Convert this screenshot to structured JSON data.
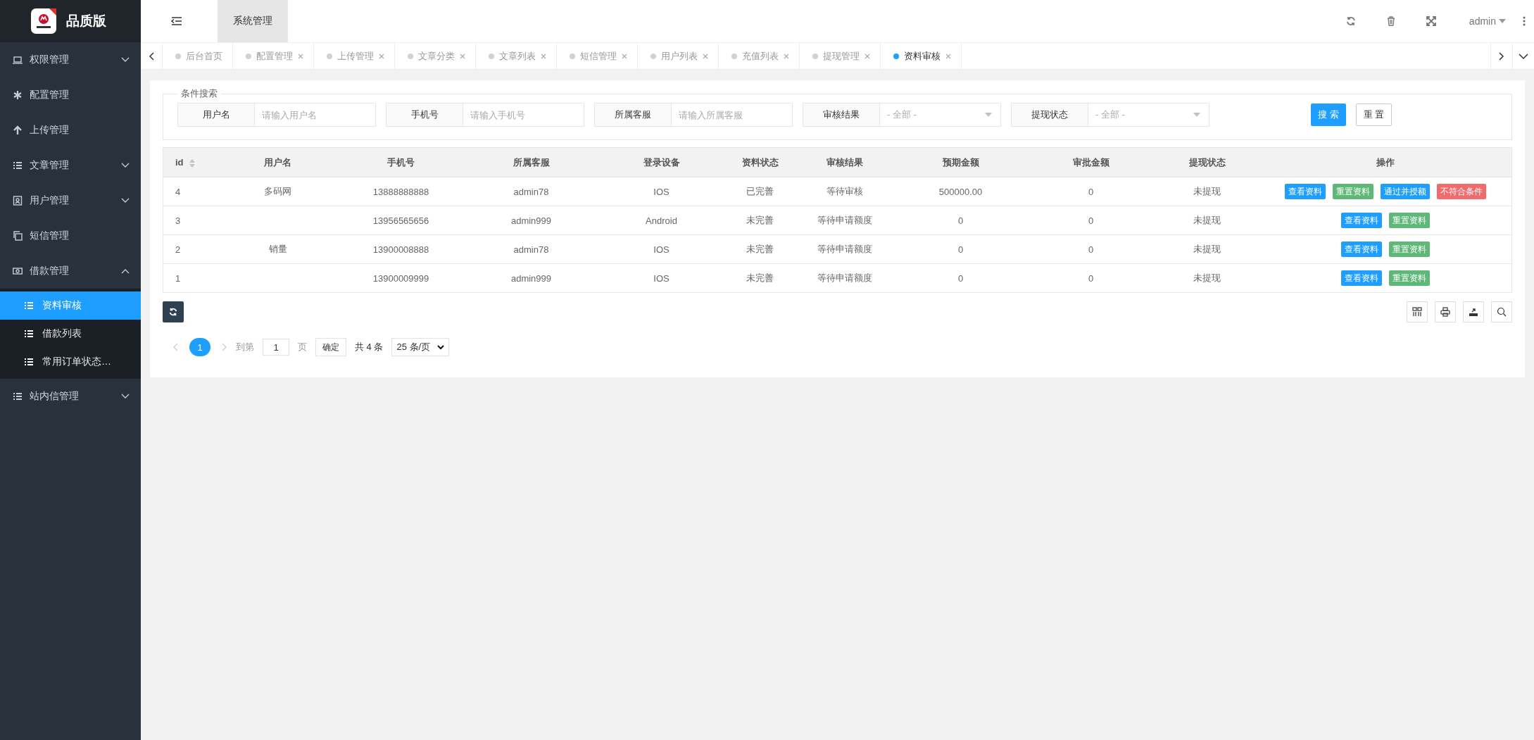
{
  "brand": {
    "title": "品质版"
  },
  "header": {
    "nav_tab": "系统管理",
    "user": "admin"
  },
  "sidebar": {
    "items": [
      {
        "label": "权限管理",
        "expanded": false,
        "selected": false
      },
      {
        "label": "配置管理",
        "selected": false
      },
      {
        "label": "上传管理",
        "selected": false
      },
      {
        "label": "文章管理",
        "expanded": false,
        "selected": false
      },
      {
        "label": "用户管理",
        "expanded": false,
        "selected": false
      },
      {
        "label": "短信管理",
        "selected": false
      },
      {
        "label": "借款管理",
        "expanded": true,
        "selected": false,
        "children": [
          {
            "label": "资料审核",
            "selected": true
          },
          {
            "label": "借款列表",
            "selected": false
          },
          {
            "label": "常用订单状态…",
            "selected": false
          }
        ]
      },
      {
        "label": "站内信管理",
        "expanded": false,
        "selected": false
      }
    ]
  },
  "tabs": [
    {
      "label": "后台首页",
      "closable": false,
      "selected": false
    },
    {
      "label": "配置管理",
      "closable": true,
      "selected": false
    },
    {
      "label": "上传管理",
      "closable": true,
      "selected": false
    },
    {
      "label": "文章分类",
      "closable": true,
      "selected": false
    },
    {
      "label": "文章列表",
      "closable": true,
      "selected": false
    },
    {
      "label": "短信管理",
      "closable": true,
      "selected": false
    },
    {
      "label": "用户列表",
      "closable": true,
      "selected": false
    },
    {
      "label": "充值列表",
      "closable": true,
      "selected": false
    },
    {
      "label": "提现管理",
      "closable": true,
      "selected": false
    },
    {
      "label": "资料审核",
      "closable": true,
      "selected": true
    }
  ],
  "search": {
    "legend": "条件搜索",
    "fields": [
      {
        "kind": "input",
        "label": "用户名",
        "placeholder": "请输入用户名"
      },
      {
        "kind": "input",
        "label": "手机号",
        "placeholder": "请输入手机号"
      },
      {
        "kind": "input",
        "label": "所属客服",
        "placeholder": "请输入所属客服"
      },
      {
        "kind": "select",
        "label": "审核结果",
        "value": "- 全部 -"
      },
      {
        "kind": "select",
        "label": "提现状态",
        "value": "- 全部 -"
      }
    ],
    "search_button": "搜 索",
    "reset_button": "重 置"
  },
  "table": {
    "columns": [
      {
        "label": "id",
        "sortable": true
      },
      {
        "label": "用户名"
      },
      {
        "label": "手机号"
      },
      {
        "label": "所属客服"
      },
      {
        "label": "登录设备"
      },
      {
        "label": "资料状态"
      },
      {
        "label": "审核结果"
      },
      {
        "label": "预期金额"
      },
      {
        "label": "审批金额"
      },
      {
        "label": "提现状态"
      },
      {
        "label": "操作"
      }
    ],
    "rows": [
      {
        "id": "4",
        "username": "多码网",
        "phone": "13888888888",
        "service": "admin78",
        "device": "IOS",
        "profile_status": "已完善",
        "review_result": "等待审核",
        "expected_amount": "500000.00",
        "approved_amount": "0",
        "withdrawal_status": "未提现",
        "actions": [
          {
            "label": "查看资料",
            "color": "#1e9fff"
          },
          {
            "label": "重置资料",
            "color": "#5fb878"
          },
          {
            "label": "通过并授额",
            "color": "#1e9fff"
          },
          {
            "label": "不符合条件",
            "color": "#f06b6b"
          }
        ]
      },
      {
        "id": "3",
        "phone": "13956565656",
        "service": "admin999",
        "device": "Android",
        "profile_status": "未完善",
        "review_result": "等待申请额度",
        "expected_amount": "0",
        "approved_amount": "0",
        "withdrawal_status": "未提现",
        "actions": [
          {
            "label": "查看资料",
            "color": "#1e9fff"
          },
          {
            "label": "重置资料",
            "color": "#5fb878"
          }
        ]
      },
      {
        "id": "2",
        "username": "销量",
        "phone": "13900008888",
        "service": "admin78",
        "device": "IOS",
        "profile_status": "未完善",
        "review_result": "等待申请额度",
        "expected_amount": "0",
        "approved_amount": "0",
        "withdrawal_status": "未提现",
        "actions": [
          {
            "label": "查看资料",
            "color": "#1e9fff"
          },
          {
            "label": "重置资料",
            "color": "#5fb878"
          }
        ]
      },
      {
        "id": "1",
        "phone": "13900009999",
        "service": "admin999",
        "device": "IOS",
        "profile_status": "未完善",
        "review_result": "等待申请额度",
        "expected_amount": "0",
        "approved_amount": "0",
        "withdrawal_status": "未提现",
        "actions": [
          {
            "label": "查看资料",
            "color": "#1e9fff"
          },
          {
            "label": "重置资料",
            "color": "#5fb878"
          }
        ]
      }
    ]
  },
  "pagination": {
    "pages": [
      {
        "label": "1",
        "selected": true
      }
    ],
    "goto_label": "到第",
    "goto_value": "1",
    "page_unit": "页",
    "confirm": "确定",
    "total": "共 4 条",
    "page_size": "25 条/页"
  }
}
